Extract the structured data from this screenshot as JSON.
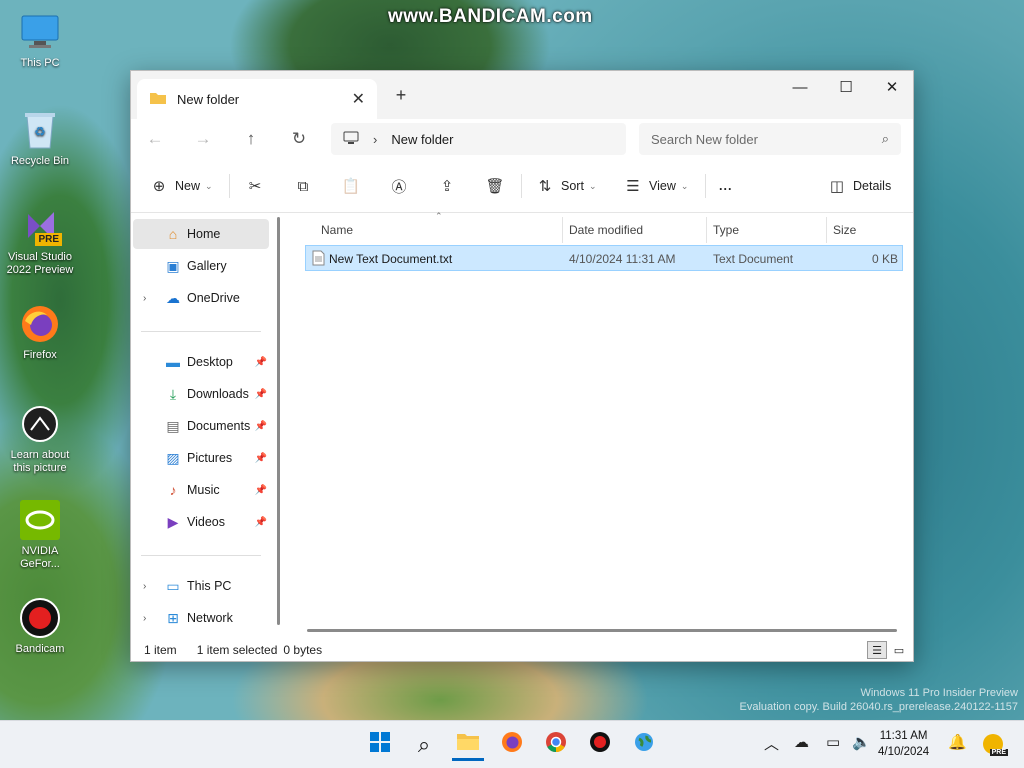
{
  "watermark": "www.BANDICAM.com",
  "desktop_icons": [
    {
      "label": "This PC"
    },
    {
      "label": "Recycle Bin"
    },
    {
      "label": "Visual Studio 2022 Preview",
      "badge": "PRE"
    },
    {
      "label": "Firefox"
    },
    {
      "label": "Learn about this picture"
    },
    {
      "label": "NVIDIA GeFor..."
    },
    {
      "label": "Bandicam"
    }
  ],
  "os_watermark": {
    "line1": "Windows 11 Pro Insider Preview",
    "line2": "Evaluation copy. Build 26040.rs_prerelease.240122-1157"
  },
  "explorer": {
    "tab_title": "New folder",
    "address": "New folder",
    "search_placeholder": "Search New folder",
    "toolbar": {
      "new": "New",
      "sort": "Sort",
      "view": "View",
      "more": "...",
      "details": "Details"
    },
    "nav": {
      "home": "Home",
      "gallery": "Gallery",
      "onedrive": "OneDrive",
      "desktop": "Desktop",
      "downloads": "Downloads",
      "documents": "Documents",
      "pictures": "Pictures",
      "music": "Music",
      "videos": "Videos",
      "thispc": "This PC",
      "network": "Network"
    },
    "columns": {
      "name": "Name",
      "date": "Date modified",
      "type": "Type",
      "size": "Size"
    },
    "files": [
      {
        "name": "New Text Document.txt",
        "date": "4/10/2024 11:31 AM",
        "type": "Text Document",
        "size": "0 KB"
      }
    ],
    "status": {
      "count": "1 item",
      "selected": "1 item selected",
      "bytes": "0 bytes"
    }
  },
  "taskbar": {
    "time": "11:31 AM",
    "date": "4/10/2024",
    "badge": "PRE"
  },
  "colors": {
    "accent": "#0067c0",
    "selection": "#cce8ff",
    "folder": "#f5c24a"
  }
}
